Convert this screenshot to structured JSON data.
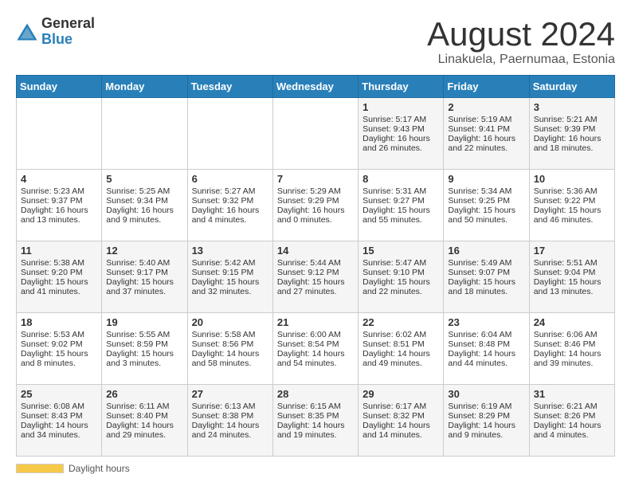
{
  "header": {
    "logo_general": "General",
    "logo_blue": "Blue",
    "title": "August 2024",
    "subtitle": "Linakuela, Paernumaa, Estonia"
  },
  "days_of_week": [
    "Sunday",
    "Monday",
    "Tuesday",
    "Wednesday",
    "Thursday",
    "Friday",
    "Saturday"
  ],
  "footer": {
    "daylight_label": "Daylight hours"
  },
  "weeks": [
    [
      {
        "day": "",
        "content": ""
      },
      {
        "day": "",
        "content": ""
      },
      {
        "day": "",
        "content": ""
      },
      {
        "day": "",
        "content": ""
      },
      {
        "day": "1",
        "content": "Sunrise: 5:17 AM\nSunset: 9:43 PM\nDaylight: 16 hours and 26 minutes."
      },
      {
        "day": "2",
        "content": "Sunrise: 5:19 AM\nSunset: 9:41 PM\nDaylight: 16 hours and 22 minutes."
      },
      {
        "day": "3",
        "content": "Sunrise: 5:21 AM\nSunset: 9:39 PM\nDaylight: 16 hours and 18 minutes."
      }
    ],
    [
      {
        "day": "4",
        "content": "Sunrise: 5:23 AM\nSunset: 9:37 PM\nDaylight: 16 hours and 13 minutes."
      },
      {
        "day": "5",
        "content": "Sunrise: 5:25 AM\nSunset: 9:34 PM\nDaylight: 16 hours and 9 minutes."
      },
      {
        "day": "6",
        "content": "Sunrise: 5:27 AM\nSunset: 9:32 PM\nDaylight: 16 hours and 4 minutes."
      },
      {
        "day": "7",
        "content": "Sunrise: 5:29 AM\nSunset: 9:29 PM\nDaylight: 16 hours and 0 minutes."
      },
      {
        "day": "8",
        "content": "Sunrise: 5:31 AM\nSunset: 9:27 PM\nDaylight: 15 hours and 55 minutes."
      },
      {
        "day": "9",
        "content": "Sunrise: 5:34 AM\nSunset: 9:25 PM\nDaylight: 15 hours and 50 minutes."
      },
      {
        "day": "10",
        "content": "Sunrise: 5:36 AM\nSunset: 9:22 PM\nDaylight: 15 hours and 46 minutes."
      }
    ],
    [
      {
        "day": "11",
        "content": "Sunrise: 5:38 AM\nSunset: 9:20 PM\nDaylight: 15 hours and 41 minutes."
      },
      {
        "day": "12",
        "content": "Sunrise: 5:40 AM\nSunset: 9:17 PM\nDaylight: 15 hours and 37 minutes."
      },
      {
        "day": "13",
        "content": "Sunrise: 5:42 AM\nSunset: 9:15 PM\nDaylight: 15 hours and 32 minutes."
      },
      {
        "day": "14",
        "content": "Sunrise: 5:44 AM\nSunset: 9:12 PM\nDaylight: 15 hours and 27 minutes."
      },
      {
        "day": "15",
        "content": "Sunrise: 5:47 AM\nSunset: 9:10 PM\nDaylight: 15 hours and 22 minutes."
      },
      {
        "day": "16",
        "content": "Sunrise: 5:49 AM\nSunset: 9:07 PM\nDaylight: 15 hours and 18 minutes."
      },
      {
        "day": "17",
        "content": "Sunrise: 5:51 AM\nSunset: 9:04 PM\nDaylight: 15 hours and 13 minutes."
      }
    ],
    [
      {
        "day": "18",
        "content": "Sunrise: 5:53 AM\nSunset: 9:02 PM\nDaylight: 15 hours and 8 minutes."
      },
      {
        "day": "19",
        "content": "Sunrise: 5:55 AM\nSunset: 8:59 PM\nDaylight: 15 hours and 3 minutes."
      },
      {
        "day": "20",
        "content": "Sunrise: 5:58 AM\nSunset: 8:56 PM\nDaylight: 14 hours and 58 minutes."
      },
      {
        "day": "21",
        "content": "Sunrise: 6:00 AM\nSunset: 8:54 PM\nDaylight: 14 hours and 54 minutes."
      },
      {
        "day": "22",
        "content": "Sunrise: 6:02 AM\nSunset: 8:51 PM\nDaylight: 14 hours and 49 minutes."
      },
      {
        "day": "23",
        "content": "Sunrise: 6:04 AM\nSunset: 8:48 PM\nDaylight: 14 hours and 44 minutes."
      },
      {
        "day": "24",
        "content": "Sunrise: 6:06 AM\nSunset: 8:46 PM\nDaylight: 14 hours and 39 minutes."
      }
    ],
    [
      {
        "day": "25",
        "content": "Sunrise: 6:08 AM\nSunset: 8:43 PM\nDaylight: 14 hours and 34 minutes."
      },
      {
        "day": "26",
        "content": "Sunrise: 6:11 AM\nSunset: 8:40 PM\nDaylight: 14 hours and 29 minutes."
      },
      {
        "day": "27",
        "content": "Sunrise: 6:13 AM\nSunset: 8:38 PM\nDaylight: 14 hours and 24 minutes."
      },
      {
        "day": "28",
        "content": "Sunrise: 6:15 AM\nSunset: 8:35 PM\nDaylight: 14 hours and 19 minutes."
      },
      {
        "day": "29",
        "content": "Sunrise: 6:17 AM\nSunset: 8:32 PM\nDaylight: 14 hours and 14 minutes."
      },
      {
        "day": "30",
        "content": "Sunrise: 6:19 AM\nSunset: 8:29 PM\nDaylight: 14 hours and 9 minutes."
      },
      {
        "day": "31",
        "content": "Sunrise: 6:21 AM\nSunset: 8:26 PM\nDaylight: 14 hours and 4 minutes."
      }
    ]
  ]
}
